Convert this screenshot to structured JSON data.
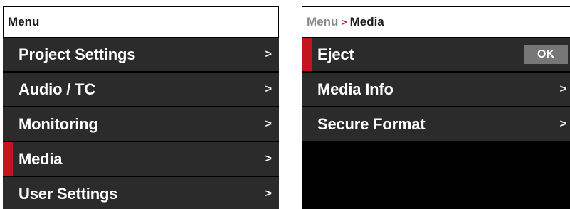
{
  "left_panel": {
    "header": "Menu",
    "items": [
      {
        "label": "Project Settings",
        "chevron": ">"
      },
      {
        "label": "Audio / TC",
        "chevron": ">"
      },
      {
        "label": "Monitoring",
        "chevron": ">"
      },
      {
        "label": "Media",
        "chevron": ">",
        "selected": true
      },
      {
        "label": "User Settings",
        "chevron": ">"
      }
    ]
  },
  "right_panel": {
    "breadcrumb": {
      "root": "Menu",
      "separator": ">",
      "current": "Media"
    },
    "items": [
      {
        "label": "Eject",
        "action": "OK",
        "selected": true
      },
      {
        "label": "Media Info",
        "chevron": ">"
      },
      {
        "label": "Secure Format",
        "chevron": ">"
      }
    ]
  },
  "colors": {
    "selection": "#c4141f",
    "row_background": "#2b2b2b",
    "panel_background": "#000000",
    "ok_button": "#777777"
  }
}
